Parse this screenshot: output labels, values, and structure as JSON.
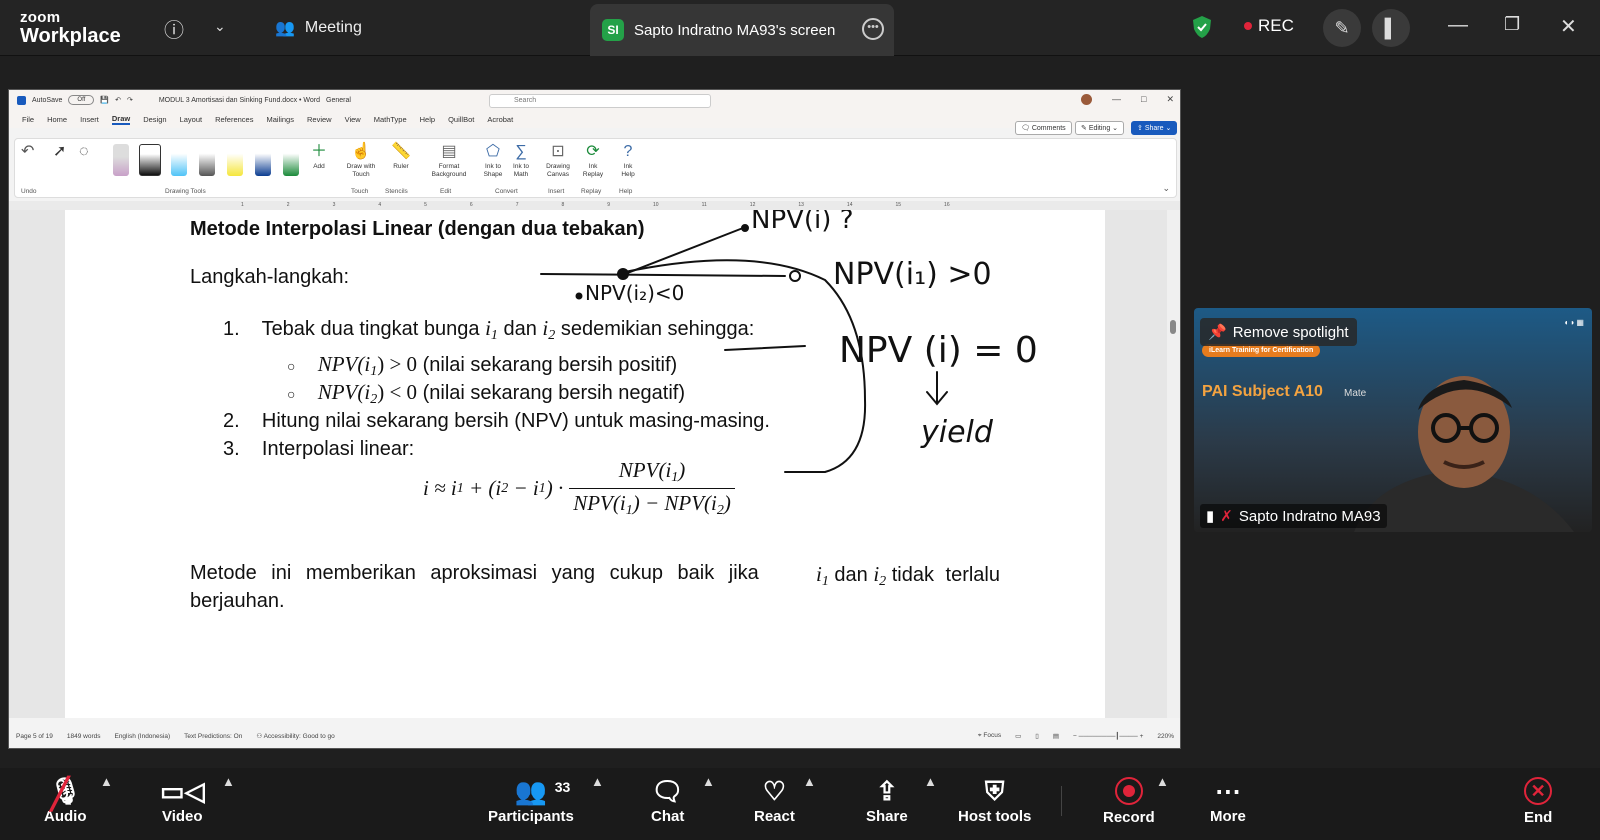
{
  "topbar": {
    "logo_line1": "zoom",
    "logo_line2": "Workplace",
    "meeting_label": "Meeting",
    "share_initials": "SI",
    "share_title": "Sapto Indratno MA93's screen",
    "rec_label": "REC"
  },
  "word": {
    "autosave": "AutoSave",
    "autosave_state": "Off",
    "doc_title": "MODUL 3 Amortisasi dan Sinking Fund.docx  •  Word",
    "sensitivity": "General",
    "search_placeholder": "Search",
    "menu": [
      "File",
      "Home",
      "Insert",
      "Draw",
      "Design",
      "Layout",
      "References",
      "Mailings",
      "Review",
      "View",
      "MathType",
      "Help",
      "QuillBot",
      "Acrobat"
    ],
    "comments_btn": "Comments",
    "editing_btn": "Editing",
    "share_btn": "Share",
    "ribbon": {
      "undo_group": "Undo",
      "drawing_tools_group": "Drawing Tools",
      "add_label": "Add",
      "draw_touch": "Draw with Touch",
      "touch_group": "Touch",
      "ruler": "Ruler",
      "stencils_group": "Stencils",
      "format_bg": "Format Background",
      "edit_group": "Edit",
      "ink_shape": "Ink to Shape",
      "ink_math": "Ink to Math",
      "convert_group": "Convert",
      "drawing_canvas": "Drawing Canvas",
      "insert_group": "Insert",
      "ink_replay": "Ink Replay",
      "replay_group": "Replay",
      "ink_help": "Ink Help",
      "help_group": "Help"
    },
    "ruler_numbers": [
      "1",
      "2",
      "3",
      "4",
      "5",
      "6",
      "7",
      "8",
      "9",
      "10",
      "11",
      "12",
      "13",
      "14",
      "15",
      "16"
    ],
    "document": {
      "heading": "Metode Interpolasi Linear (dengan dua tebakan)",
      "steps_label": "Langkah-langkah:",
      "step1_num": "1.",
      "step1_text": "Tebak dua tingkat bunga",
      "step1_and": "dan",
      "step1_tail": "sedemikian sehingga:",
      "bullet1_math": "NPV(i",
      "bullet1_rel": ") > 0",
      "bullet1_text": "(nilai sekarang bersih positif)",
      "bullet2_math": "NPV(i",
      "bullet2_rel": ") < 0",
      "bullet2_text": "(nilai sekarang bersih negatif)",
      "step2_num": "2.",
      "step2_text": "Hitung nilai sekarang bersih (NPV) untuk masing-masing.",
      "step3_num": "3.",
      "step3_text": "Interpolasi linear:",
      "formula_lhs": "i ≈ i",
      "formula_mid": " + (i",
      "formula_minus": " − i",
      "formula_close": ") ·",
      "formula_num": "NPV(i",
      "formula_den_a": "NPV(i",
      "formula_den_b": ") − NPV(i",
      "closing_a": "Metode ini memberikan aproksimasi yang cukup baik jika",
      "closing_and": "dan",
      "closing_b": "tidak terlalu",
      "closing_c": "berjauhan."
    },
    "ink_notes": {
      "top": "NPV(i) ?",
      "left": "NPV(i₂)<0",
      "right": "NPV(i₁) >0",
      "eq": "NPV (i) = 0",
      "yield": "yield"
    },
    "status": {
      "page": "Page 5 of 19",
      "words": "1849 words",
      "language": "English (Indonesia)",
      "predictions": "Text Predictions: On",
      "accessibility": "Accessibility: Good to go",
      "focus": "Focus",
      "zoom": "220%"
    }
  },
  "video": {
    "remove_spotlight": "Remove spotlight",
    "banner": "iLearn Training for Certification",
    "subject": "PAI Subject A10",
    "subject_tail": "Mate",
    "name": "Sapto Indratno MA93"
  },
  "toolbar": {
    "audio": "Audio",
    "video": "Video",
    "participants": "Participants",
    "participants_count": "33",
    "chat": "Chat",
    "react": "React",
    "share": "Share",
    "host_tools": "Host tools",
    "record": "Record",
    "more": "More",
    "end": "End"
  },
  "colors": {
    "accent_green": "#24a148",
    "record_red": "#e0243a",
    "word_blue": "#185abd"
  }
}
